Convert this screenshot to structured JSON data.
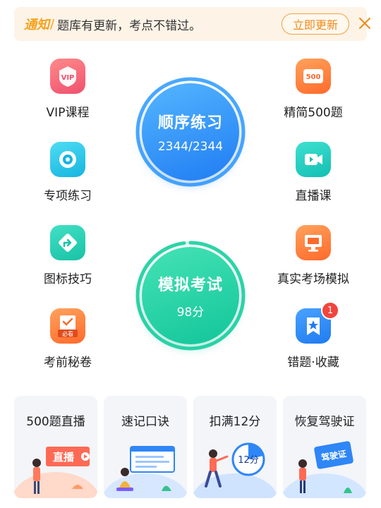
{
  "notice": {
    "tag": "通知",
    "slash": "/",
    "message": "题库有更新，考点不错过。",
    "update_button": "立即更新"
  },
  "left_tiles": [
    {
      "label": "VIP课程",
      "icon": "vip-badge-icon"
    },
    {
      "label": "专项练习",
      "icon": "target-icon"
    },
    {
      "label": "图标技巧",
      "icon": "turn-arrow-sign-icon"
    },
    {
      "label": "考前秘卷",
      "icon": "must-read-paper-icon",
      "icon_text": "必看"
    }
  ],
  "right_tiles": [
    {
      "label": "精简500题",
      "icon": "500-badge-icon",
      "icon_text": "500"
    },
    {
      "label": "直播课",
      "icon": "video-camera-icon"
    },
    {
      "label": "真实考场模拟",
      "icon": "monitor-icon"
    },
    {
      "label": "错题·收藏",
      "icon": "star-bookmark-icon",
      "badge": "1"
    }
  ],
  "circles": {
    "practice": {
      "title": "顺序练习",
      "subtitle": "2344/2344",
      "progress": 1.0
    },
    "exam": {
      "title": "模拟考试",
      "subtitle": "98分",
      "progress": 0.98
    }
  },
  "cards": [
    {
      "title": "500题直播",
      "illustration_text": "直播"
    },
    {
      "title": "速记口诀",
      "illustration_text": ""
    },
    {
      "title": "扣满12分",
      "illustration_text": "12分"
    },
    {
      "title": "恢复驾驶证",
      "illustration_text": "驾驶证"
    }
  ],
  "colors": {
    "accent_orange": "#f7a21b",
    "practice_blue": "#1f7cf3",
    "exam_green": "#12c59a",
    "badge_red": "#f2453d"
  }
}
